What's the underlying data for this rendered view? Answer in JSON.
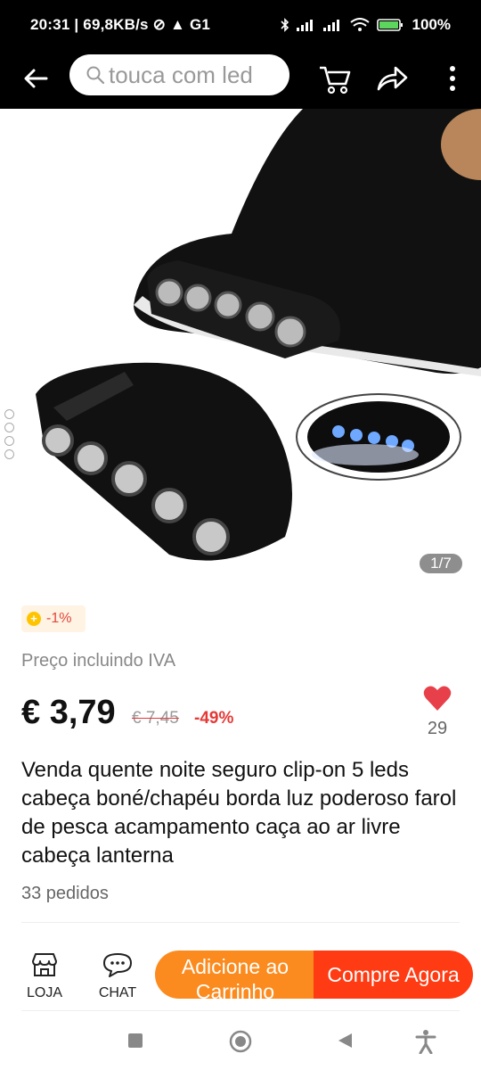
{
  "status_bar": {
    "time": "20:31",
    "speed": "69,8KB/s",
    "battery": "100%"
  },
  "header": {
    "search_placeholder": "touca com led",
    "icons": [
      "back-arrow-icon",
      "cart-icon",
      "share-icon",
      "more-icon"
    ]
  },
  "gallery": {
    "counter": "1/7",
    "dots": 4
  },
  "product": {
    "promo_badge": "-1%",
    "vat_note": "Preço incluindo IVA",
    "price": "€ 3,79",
    "old_price": "€ 7,45",
    "discount": "-49%",
    "likes": "29",
    "title": "Venda quente noite seguro clip-on 5 leds cabeça boné/chapéu borda luz poderoso farol de pesca acampamento caça ao ar livre cabeça lanterna",
    "orders": "33 pedidos"
  },
  "bottom_bar": {
    "store_label": "LOJA",
    "chat_label": "CHAT",
    "add_to_cart": "Adicione ao Carrinho",
    "buy_now": "Compre Agora"
  },
  "colors": {
    "accent_orange": "#fb8b1e",
    "accent_red": "#ff3b14",
    "discount_red": "#e53935"
  }
}
